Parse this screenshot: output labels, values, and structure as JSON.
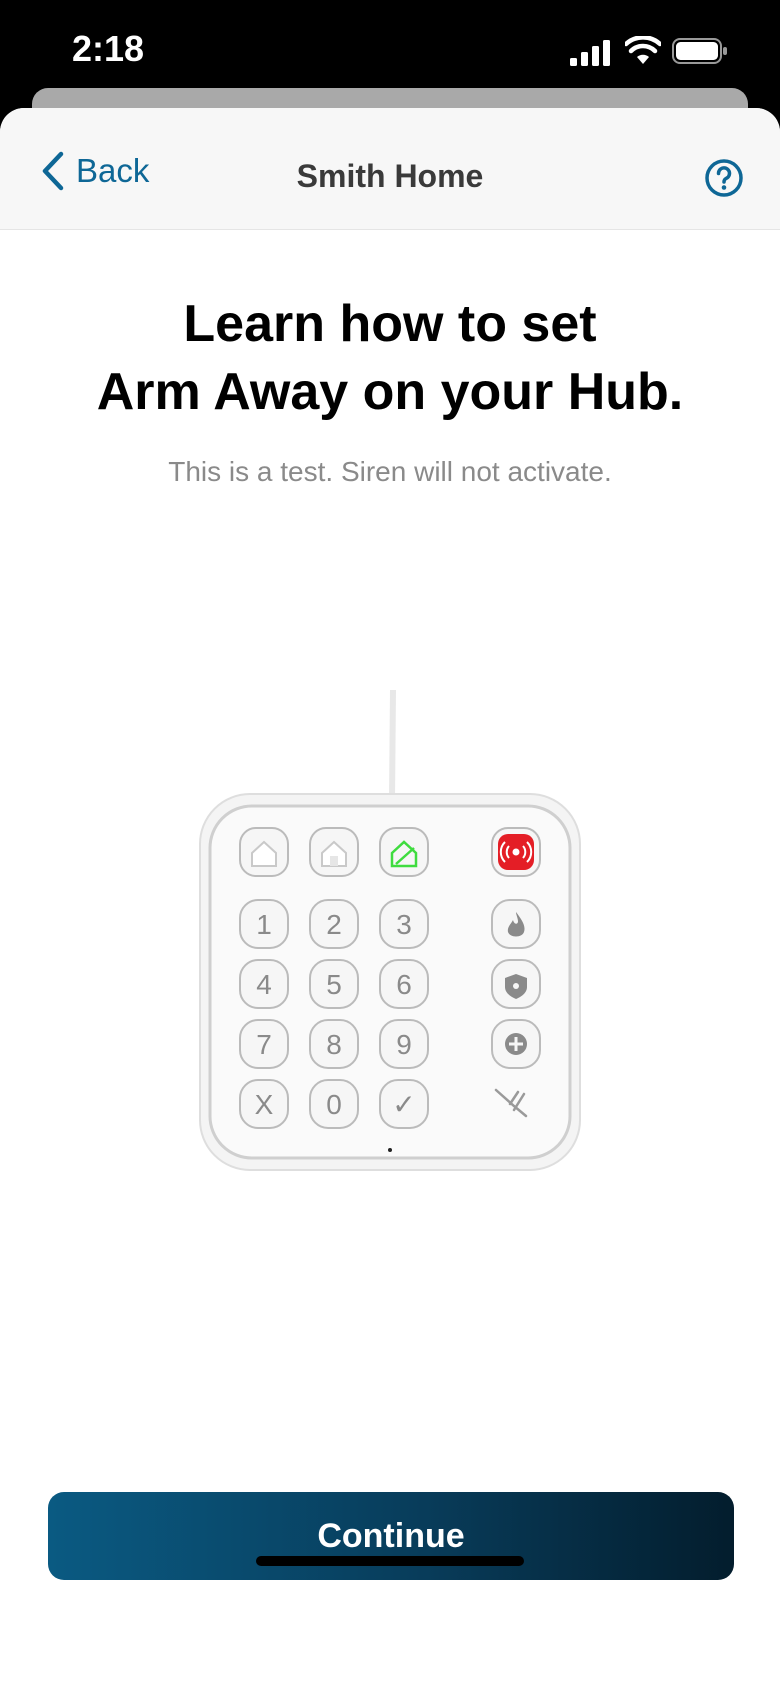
{
  "status": {
    "time": "2:18"
  },
  "nav": {
    "back_label": "Back",
    "title": "Smith Home"
  },
  "content": {
    "heading_line1": "Learn how to set",
    "heading_line2": "Arm Away on your Hub.",
    "subtext": "This is a test. Siren will not activate."
  },
  "keypad": {
    "digits": [
      "1",
      "2",
      "3",
      "4",
      "5",
      "6",
      "7",
      "8",
      "9",
      "X",
      "0",
      "✓"
    ],
    "mode_icons": [
      "home-icon",
      "arm-home-icon",
      "arm-away-icon"
    ],
    "side_icons": [
      "siren-icon",
      "fire-icon",
      "police-icon",
      "medical-icon"
    ],
    "accent_green": "#3fdc3f",
    "accent_red": "#e41e26"
  },
  "actions": {
    "continue_label": "Continue"
  },
  "colors": {
    "link": "#0e6796",
    "button_start": "#0a5a82",
    "button_end": "#031d2d"
  }
}
